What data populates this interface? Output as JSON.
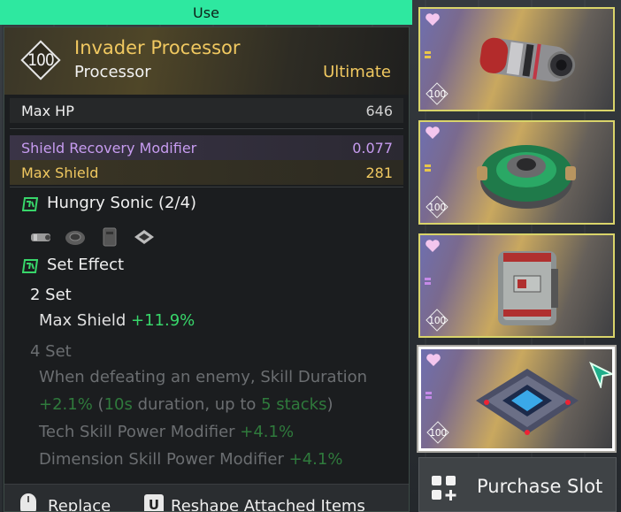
{
  "top_bar": {
    "use_label": "Use"
  },
  "item": {
    "level": "100",
    "name": "Invader Processor",
    "type": "Processor",
    "grade": "Ultimate"
  },
  "stats": [
    {
      "label": "Max HP",
      "value": "646"
    },
    {
      "label": "Shield Recovery Modifier",
      "value": "0.077"
    },
    {
      "label": "Max Shield",
      "value": "281"
    }
  ],
  "set": {
    "title": "Hungry Sonic",
    "count": "(2/4)",
    "effect_title": "Set Effect",
    "set2_label": "2 Set",
    "set2_stat": "Max Shield",
    "set2_value": "+11.9%",
    "set4_label": "4 Set",
    "set4_line1": "When defeating an enemy, Skill Duration",
    "set4_line2_a": "+2.1%",
    "set4_line2_b": " (",
    "set4_line2_c": "10s",
    "set4_line2_d": " duration, up to ",
    "set4_line2_e": "5 stacks",
    "set4_line2_f": ")",
    "set4_line3_a": "Tech Skill Power Modifier ",
    "set4_line3_b": "+4.1%",
    "set4_line4_a": "Dimension Skill Power Modifier ",
    "set4_line4_b": "+4.1%"
  },
  "footer": {
    "replace_label": "Replace",
    "u_key": "U",
    "reshape_label": "Reshape Attached Items"
  },
  "slots": [
    {
      "level": "100",
      "icon": "canister-core-icon"
    },
    {
      "level": "100",
      "icon": "green-ring-core-icon"
    },
    {
      "level": "100",
      "icon": "battery-pack-icon"
    },
    {
      "level": "100",
      "icon": "processor-chip-icon"
    }
  ],
  "purchase": {
    "label": "Purchase Slot"
  },
  "colors": {
    "accent_green": "#2ee8a0",
    "ultimate_gold": "#f0c860",
    "purple_stat": "#c79cf0",
    "bonus_green": "#38d66a"
  }
}
